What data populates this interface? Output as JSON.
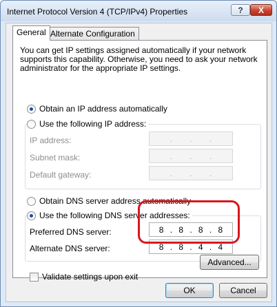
{
  "window": {
    "title": "Internet Protocol Version 4 (TCP/IPv4) Properties",
    "help_label": "?",
    "close_label": "X"
  },
  "tabs": [
    {
      "label": "General",
      "active": true
    },
    {
      "label": "Alternate Configuration",
      "active": false
    }
  ],
  "intro": "You can get IP settings assigned automatically if your network supports this capability. Otherwise, you need to ask your network administrator for the appropriate IP settings.",
  "ip": {
    "auto_label": "Obtain an IP address automatically",
    "auto_selected": true,
    "manual_label": "Use the following IP address:",
    "fields": [
      {
        "label": "IP address:",
        "octets": [
          "",
          "",
          "",
          ""
        ]
      },
      {
        "label": "Subnet mask:",
        "octets": [
          "",
          "",
          "",
          ""
        ]
      },
      {
        "label": "Default gateway:",
        "octets": [
          "",
          "",
          "",
          ""
        ]
      }
    ]
  },
  "dns": {
    "auto_label": "Obtain DNS server address automatically",
    "manual_label": "Use the following DNS server addresses:",
    "manual_selected": true,
    "preferred": {
      "label": "Preferred DNS server:",
      "octets": [
        "8",
        "8",
        "8",
        "8"
      ]
    },
    "alternate": {
      "label": "Alternate DNS server:",
      "octets": [
        "8",
        "8",
        "4",
        "4"
      ]
    }
  },
  "validate": {
    "label": "Validate settings upon exit",
    "checked": false
  },
  "buttons": {
    "advanced": "Advanced...",
    "ok": "OK",
    "cancel": "Cancel"
  },
  "colors": {
    "highlight": "#d8161c",
    "selected_radio": "#1d4ea8"
  }
}
